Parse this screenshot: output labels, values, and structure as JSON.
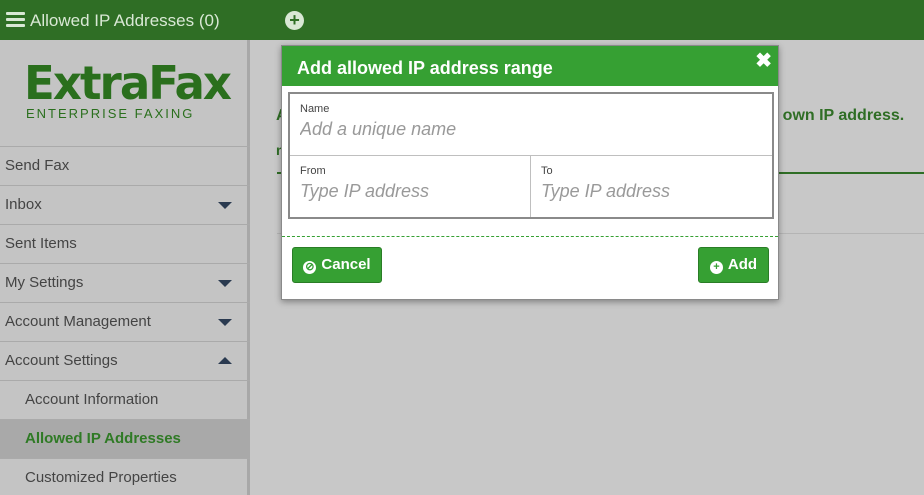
{
  "topbar": {
    "title": "Allowed IP Addresses (0)",
    "menu_icon": "hamburger-icon",
    "add_icon": "plus-circle-icon"
  },
  "logo": {
    "word": "ExtraFax",
    "tagline": "ENTERPRISE FAXING"
  },
  "sidebar": {
    "items": [
      {
        "label": "Send Fax",
        "caret": "none"
      },
      {
        "label": "Inbox",
        "caret": "down"
      },
      {
        "label": "Sent Items",
        "caret": "none"
      },
      {
        "label": "My Settings",
        "caret": "down"
      },
      {
        "label": "Account Management",
        "caret": "down"
      },
      {
        "label": "Account Settings",
        "caret": "up"
      },
      {
        "label": "Account Information",
        "sub": true
      },
      {
        "label": "Allowed IP Addresses",
        "sub": true,
        "active": true
      },
      {
        "label": "Customized Properties",
        "sub": true
      }
    ]
  },
  "background": {
    "fragment_left": "A",
    "fragment_right": "r own IP address.",
    "fragment_left2": "n"
  },
  "modal": {
    "title": "Add allowed IP address range",
    "close_icon": "close-icon",
    "name_label": "Name",
    "name_placeholder": "Add a unique name",
    "from_label": "From",
    "from_placeholder": "Type IP address",
    "to_label": "To",
    "to_placeholder": "Type IP address",
    "cancel_label": "Cancel",
    "add_label": "Add"
  },
  "colors": {
    "topbar": "#2f6e25",
    "accent": "#36a033",
    "sidebar": "#c4c4c4"
  }
}
